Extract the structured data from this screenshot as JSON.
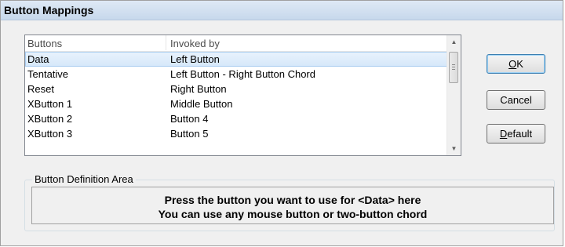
{
  "window": {
    "title": "Button Mappings"
  },
  "list": {
    "columns": [
      "Buttons",
      "Invoked by"
    ],
    "rows": [
      {
        "button": "Data",
        "invoked_by": "Left Button",
        "selected": true
      },
      {
        "button": "Tentative",
        "invoked_by": "Left Button - Right Button Chord"
      },
      {
        "button": "Reset",
        "invoked_by": "Right Button"
      },
      {
        "button": "XButton 1",
        "invoked_by": "Middle Button"
      },
      {
        "button": "XButton 2",
        "invoked_by": "Button 4"
      },
      {
        "button": "XButton 3",
        "invoked_by": "Button 5"
      }
    ]
  },
  "buttons": {
    "ok": {
      "pre": "",
      "accel": "O",
      "post": "K"
    },
    "cancel": "Cancel",
    "default": {
      "pre": "",
      "accel": "D",
      "post": "efault"
    }
  },
  "definition_area": {
    "label": "Button Definition Area",
    "line1": "Press the button you want to use for <Data> here",
    "line2": "You can use any mouse button or two-button chord"
  },
  "icons": {
    "scroll_up": "up-arrow",
    "scroll_down": "down-arrow"
  },
  "colors": {
    "title_bar": "#c7d8ec",
    "selection": "#d6e8fa",
    "dialog_bg": "#f0f0f0"
  }
}
